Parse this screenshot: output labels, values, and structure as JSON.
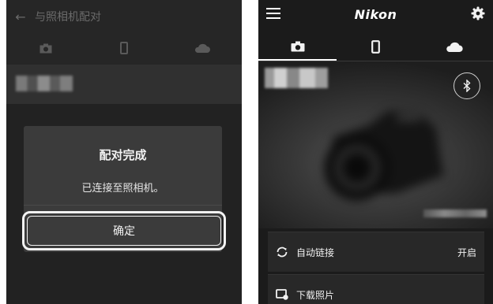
{
  "left_screen": {
    "header": {
      "back_icon": "arrow-left-icon",
      "title": "与照相机配对"
    },
    "tabs": [
      {
        "icon": "camera-icon"
      },
      {
        "icon": "phone-icon"
      },
      {
        "icon": "cloud-icon"
      }
    ],
    "dialog": {
      "title": "配对完成",
      "message": "已连接至照相机。",
      "confirm_label": "确定"
    }
  },
  "right_screen": {
    "header": {
      "menu_icon": "hamburger-menu-icon",
      "brand": "Nikon",
      "settings_icon": "gear-icon"
    },
    "tabs": [
      {
        "icon": "camera-icon",
        "active": true
      },
      {
        "icon": "phone-icon",
        "active": false
      },
      {
        "icon": "cloud-icon",
        "active": false
      }
    ],
    "bluetooth_icon": "bluetooth-icon",
    "menu_items": [
      {
        "icon": "sync-icon",
        "label": "自动链接",
        "value": "开启"
      },
      {
        "icon": "download-photo-icon",
        "label": "下载照片"
      }
    ]
  },
  "colors": {
    "dark_bg": "#1b1b1b",
    "dialog_bg": "#3b3b3b",
    "text": "#f2f2f2",
    "dim_text": "#6a6a6a"
  }
}
